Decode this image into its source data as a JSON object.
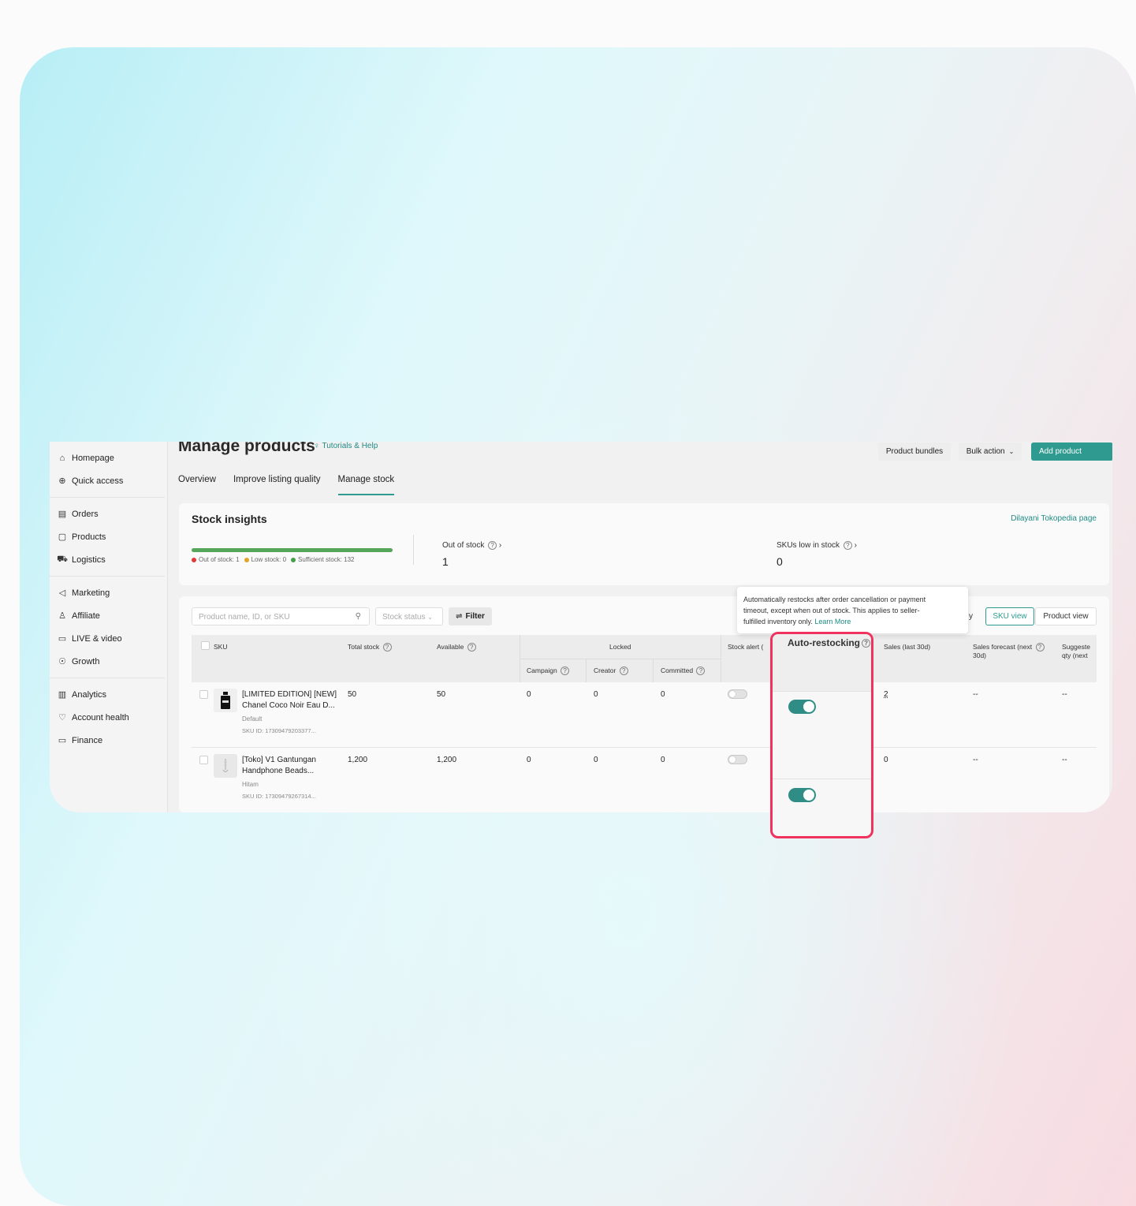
{
  "sidebar": {
    "groups": [
      [
        {
          "label": "Homepage",
          "icon": "home-icon",
          "glyph": "⌂"
        },
        {
          "label": "Quick access",
          "icon": "quick-access-icon",
          "glyph": "⊕"
        }
      ],
      [
        {
          "label": "Orders",
          "icon": "orders-icon",
          "glyph": "▤"
        },
        {
          "label": "Products",
          "icon": "products-icon",
          "glyph": "▢"
        },
        {
          "label": "Logistics",
          "icon": "truck-icon",
          "glyph": "⛟"
        }
      ],
      [
        {
          "label": "Marketing",
          "icon": "megaphone-icon",
          "glyph": "◁"
        },
        {
          "label": "Affiliate",
          "icon": "users-icon",
          "glyph": "♙"
        },
        {
          "label": "LIVE & video",
          "icon": "video-icon",
          "glyph": "▭"
        },
        {
          "label": "Growth",
          "icon": "growth-icon",
          "glyph": "☉"
        }
      ],
      [
        {
          "label": "Analytics",
          "icon": "chart-icon",
          "glyph": "▥"
        },
        {
          "label": "Account health",
          "icon": "health-icon",
          "glyph": "♡"
        },
        {
          "label": "Finance",
          "icon": "wallet-icon",
          "glyph": "▭"
        }
      ]
    ]
  },
  "header": {
    "title": "Manage products",
    "tutorials": "Tutorials & Help",
    "product_bundles": "Product bundles",
    "bulk_action": "Bulk action",
    "add_product": "Add product"
  },
  "tabs": [
    {
      "label": "Overview",
      "active": false
    },
    {
      "label": "Improve listing quality",
      "active": false
    },
    {
      "label": "Manage stock",
      "active": true
    }
  ],
  "insights": {
    "title": "Stock insights",
    "link": "Dilayani Tokopedia page",
    "legend": {
      "out": "Out of stock: 1",
      "low": "Low stock: 0",
      "sufficient": "Sufficient stock: 132"
    },
    "colors": {
      "out": "#e53935",
      "low": "#e0a526",
      "sufficient": "#43a047"
    },
    "out_of_stock_label": "Out of stock",
    "out_of_stock_value": "1",
    "low_stock_label": "SKUs low in stock",
    "low_stock_value": "0"
  },
  "toolbar": {
    "search_placeholder": "Product name, ID, or SKU",
    "stock_status": "Stock status",
    "filter": "Filter",
    "fragment": "y",
    "sku_view": "SKU view",
    "product_view": "Product view"
  },
  "table": {
    "headers": {
      "sku": "SKU",
      "total_stock": "Total stock",
      "available": "Available",
      "locked": "Locked",
      "campaign": "Campaign",
      "creator": "Creator",
      "committed": "Committed",
      "stock_alert": "Stock alert",
      "sales": "Sales (last 30d)",
      "forecast_1": "Sales forecast (next",
      "forecast_2": "30d)",
      "suggested_1": "Suggeste",
      "suggested_2": "qty (next"
    },
    "rows": [
      {
        "name_1": "[LIMITED EDITION] [NEW]",
        "name_2": "Chanel Coco Noir Eau D...",
        "variant": "Default",
        "sku_id": "SKU ID: 17309479203377...",
        "total": "50",
        "available": "50",
        "campaign": "0",
        "creator": "0",
        "committed": "0",
        "sales": "2",
        "forecast": "--",
        "suggested": "--"
      },
      {
        "name_1": "[Toko] V1 Gantungan",
        "name_2": "Handphone Beads...",
        "variant": "Hitam",
        "sku_id": "SKU ID: 17309479267314...",
        "total": "1,200",
        "available": "1,200",
        "campaign": "0",
        "creator": "0",
        "committed": "0",
        "sales": "0",
        "forecast": "--",
        "suggested": "--"
      }
    ]
  },
  "tooltip": {
    "line1": "Automatically restocks after order cancellation or payment",
    "line2": "timeout, except when out of stock. This applies to seller-",
    "line3": "fulfilled inventory only. ",
    "learn_more": "Learn More"
  },
  "auto_restocking": {
    "title": "Auto-restocking",
    "toggles": [
      true,
      true
    ]
  },
  "colors": {
    "accent": "#2f9a8f",
    "highlight": "#f0325e"
  }
}
